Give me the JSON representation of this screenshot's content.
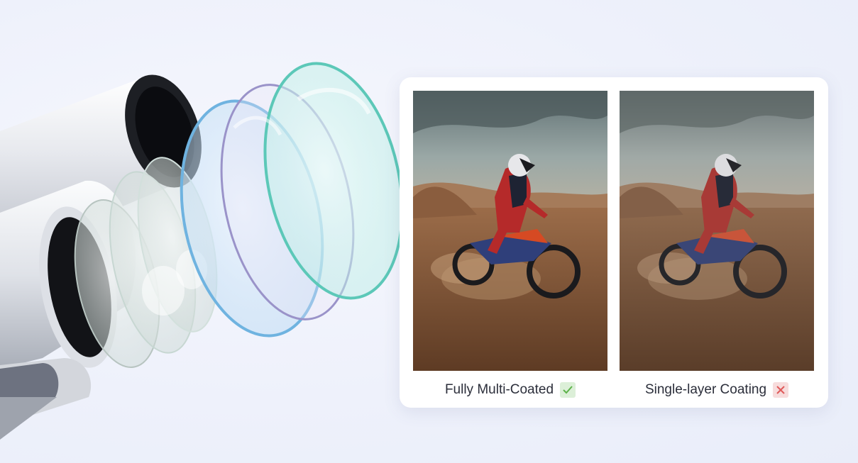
{
  "comparison": {
    "left": {
      "caption": "Fully Multi-Coated",
      "badge": "check-icon",
      "badge_color": "#5db34a"
    },
    "right": {
      "caption": "Single-layer Coating",
      "badge": "cross-icon",
      "badge_color": "#e05a5a"
    }
  },
  "colors": {
    "background": "#eef1fb",
    "lens_blue": "#6fb3e0",
    "lens_teal": "#5cc8b8",
    "lens_violet": "#9a93c9"
  }
}
